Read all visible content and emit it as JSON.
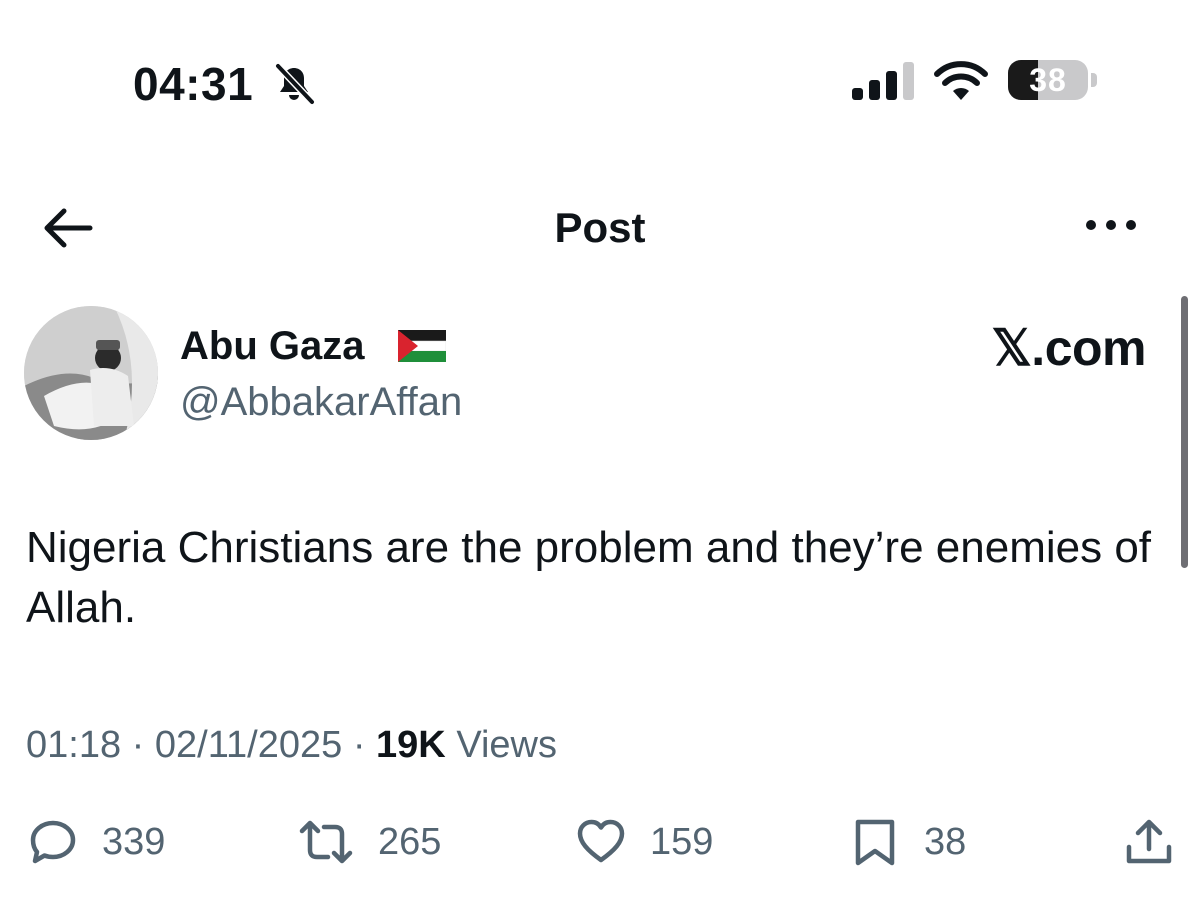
{
  "status_bar": {
    "time": "04:31",
    "battery": "38",
    "battery_level_percent": 38
  },
  "header": {
    "title": "Post"
  },
  "author": {
    "display_name": "Abu Gaza",
    "handle": "@AbbakarAffan"
  },
  "watermark": "𝕏.com",
  "post": {
    "text": "Nigeria Christians are the problem and they’re enemies of Allah.",
    "time": "01:18",
    "date": "02/11/2025",
    "views_count": "19K",
    "views_label": "Views",
    "separator": "·"
  },
  "actions": {
    "replies": "339",
    "reposts": "265",
    "likes": "159",
    "bookmarks": "38"
  },
  "colors": {
    "text_primary": "#0f1419",
    "text_secondary": "#536471",
    "background": "#ffffff"
  },
  "icons": [
    "bell-slash-icon",
    "cellular-signal-icon",
    "wifi-icon",
    "battery-icon",
    "back-arrow-icon",
    "more-icon",
    "palestine-flag-icon",
    "reply-icon",
    "repost-icon",
    "like-icon",
    "bookmark-icon",
    "share-icon"
  ]
}
